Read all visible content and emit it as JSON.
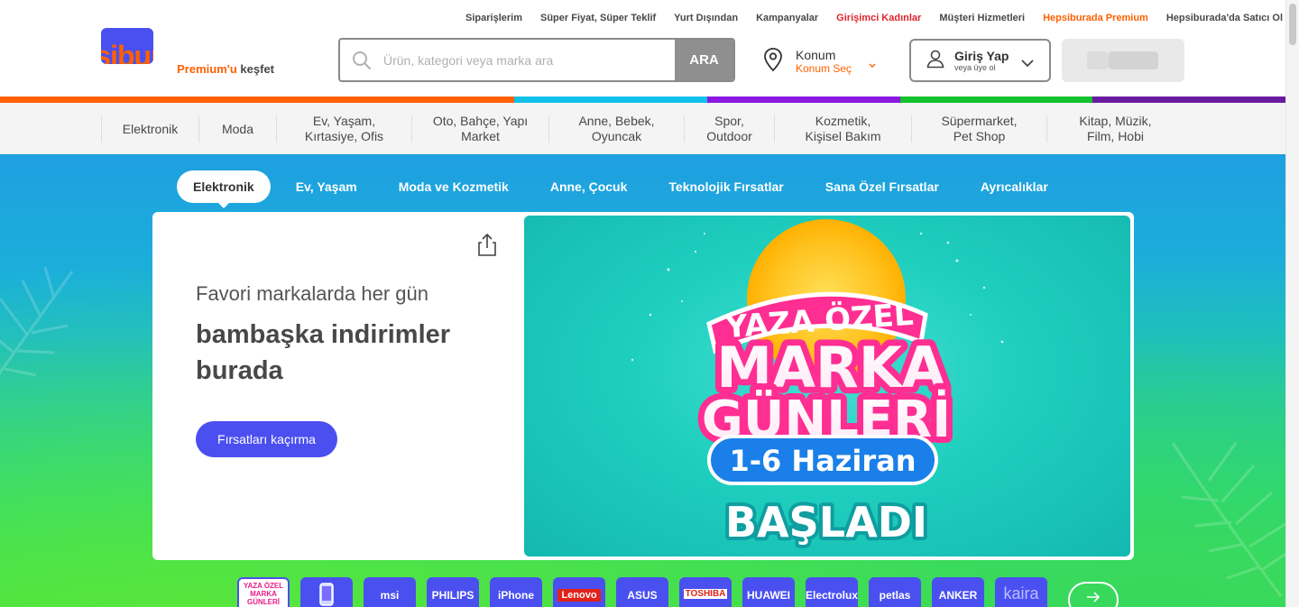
{
  "top_links": [
    {
      "label": "Siparişlerim",
      "style": "normal"
    },
    {
      "label": "Süper Fiyat, Süper Teklif",
      "style": "normal"
    },
    {
      "label": "Yurt Dışından",
      "style": "normal"
    },
    {
      "label": "Kampanyalar",
      "style": "normal"
    },
    {
      "label": "Girişimci Kadınlar",
      "style": "red"
    },
    {
      "label": "Müşteri Hizmetleri",
      "style": "normal"
    },
    {
      "label": "Hepsiburada Premium",
      "style": "orange"
    },
    {
      "label": "Hepsiburada'da Satıcı Ol",
      "style": "normal"
    }
  ],
  "logo": {
    "brand": "hepsiburada",
    "premium": "Premium'u",
    "kesfet": "keşfet"
  },
  "search": {
    "placeholder": "Ürün, kategori veya marka ara",
    "value": "",
    "button": "ARA"
  },
  "location": {
    "title": "Konum",
    "action": "Konum Seç"
  },
  "login": {
    "title": "Giriş Yap",
    "subtitle": "veya üye ol"
  },
  "colors": {
    "brand_orange": "#ff6000",
    "stripe": [
      "#ff6000",
      "#11c0e8",
      "#8a18e0",
      "#12c12b",
      "#6a1aa0"
    ],
    "cta_blue": "#4b4ff0"
  },
  "categories": [
    {
      "label": "Elektronik",
      "w": 0
    },
    {
      "label": "Moda",
      "w": 0
    },
    {
      "label": "Ev, Yaşam,\nKırtasiye, Ofis",
      "w": 0
    },
    {
      "label": "Oto, Bahçe, Yapı\nMarket",
      "w": 0
    },
    {
      "label": "Anne, Bebek,\nOyuncak",
      "w": 0
    },
    {
      "label": "Spor,\nOutdoor",
      "w": 0
    },
    {
      "label": "Kozmetik,\nKişisel Bakım",
      "w": 0
    },
    {
      "label": "Süpermarket,\nPet Shop",
      "w": 0
    },
    {
      "label": "Kitap, Müzik,\nFilm, Hobi",
      "w": 0
    }
  ],
  "hero_tabs": [
    {
      "label": "Elektronik",
      "active": true
    },
    {
      "label": "Ev, Yaşam",
      "active": false
    },
    {
      "label": "Moda ve Kozmetik",
      "active": false
    },
    {
      "label": "Anne, Çocuk",
      "active": false
    },
    {
      "label": "Teknolojik Fırsatlar",
      "active": false
    },
    {
      "label": "Sana Özel Fırsatlar",
      "active": false
    },
    {
      "label": "Ayrıcalıklar",
      "active": false
    }
  ],
  "hero": {
    "line1": "Favori markalarda her gün",
    "line2": "bambaşka indirimler burada",
    "cta": "Fırsatları kaçırma"
  },
  "banner": {
    "line1": "YAZA ÖZEL",
    "line2": "MARKA",
    "line3": "GÜNLERİ",
    "line4": "1-6 Haziran",
    "line5": "BAŞLADI"
  },
  "brands": [
    {
      "label": "YAZA ÖZEL MARKA GÜNLERİ",
      "kind": "first"
    },
    {
      "label": "",
      "kind": "phone-icon"
    },
    {
      "label": "msi",
      "kind": "plain"
    },
    {
      "label": "PHILIPS",
      "kind": "plain"
    },
    {
      "label": "iPhone",
      "kind": "plain"
    },
    {
      "label": "Lenovo",
      "kind": "lenovo"
    },
    {
      "label": "ASUS",
      "kind": "plain"
    },
    {
      "label": "TOSHIBA",
      "kind": "toshiba"
    },
    {
      "label": "HUAWEI",
      "kind": "plain"
    },
    {
      "label": "Electrolux",
      "kind": "plain"
    },
    {
      "label": "petlas",
      "kind": "plain"
    },
    {
      "label": "ANKER",
      "kind": "plain"
    },
    {
      "label": "kaira",
      "kind": "kaira"
    }
  ]
}
